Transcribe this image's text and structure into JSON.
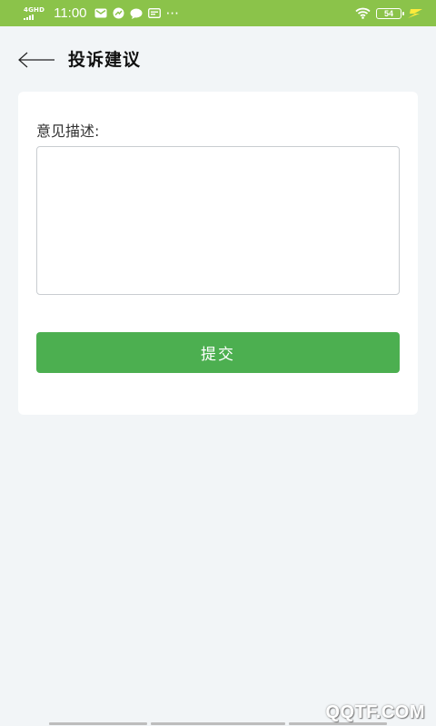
{
  "status_bar": {
    "network": "4GHD",
    "time": "11:00",
    "more": "···",
    "battery": "54"
  },
  "header": {
    "title": "投诉建议"
  },
  "form": {
    "description_label": "意见描述:",
    "description_value": "",
    "description_placeholder": "",
    "submit_label": "提交"
  },
  "watermark": "QQTF.COM",
  "colors": {
    "status_bar": "#8bc34a",
    "submit_button": "#4caf50",
    "page_background": "#f2f5f7",
    "card_background": "#ffffff"
  }
}
